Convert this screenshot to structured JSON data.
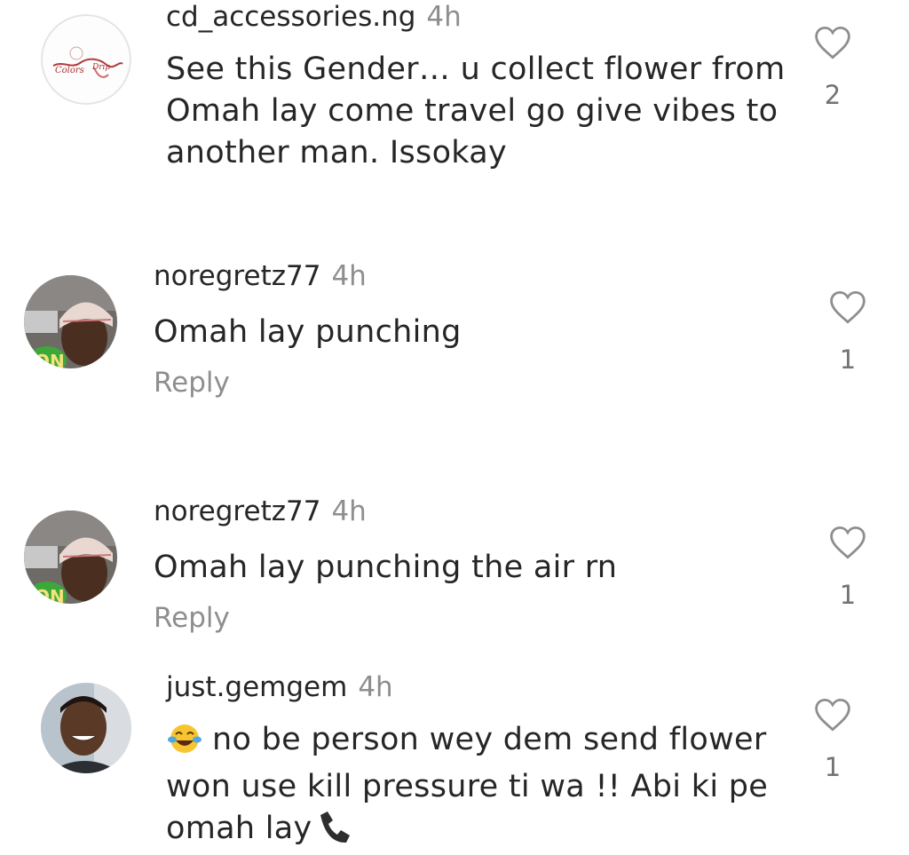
{
  "comments": [
    {
      "username": "cd_accessories.ng",
      "time": "4h",
      "text": "See this Gender… u collect flower from Omah lay come travel go give vibes to another man. Issokay",
      "likes": "2",
      "avatar": "colors-drip-logo"
    },
    {
      "username": "noregretz77",
      "time": "4h",
      "text": "Omah lay punching",
      "reply_label": "Reply",
      "likes": "1",
      "avatar": "user-with-bucket-hat"
    },
    {
      "username": "noregretz77",
      "time": "4h",
      "text": "Omah lay punching the air rn",
      "reply_label": "Reply",
      "likes": "1",
      "avatar": "user-with-bucket-hat"
    },
    {
      "username": "just.gemgem",
      "time": "4h",
      "text_part1": "no be person wey dem send flower won use kill pressure ti wa !! Abi ki pe omah lay",
      "likes": "1",
      "avatar": "smiling-man"
    }
  ],
  "colors": {
    "text": "#262626",
    "muted": "#8e8e8e",
    "like_outline": "#8e8e8e"
  },
  "icons": {
    "like": "heart-outline-icon",
    "emoji": "laughing-tears-emoji",
    "phone": "telephone-receiver-emoji"
  }
}
